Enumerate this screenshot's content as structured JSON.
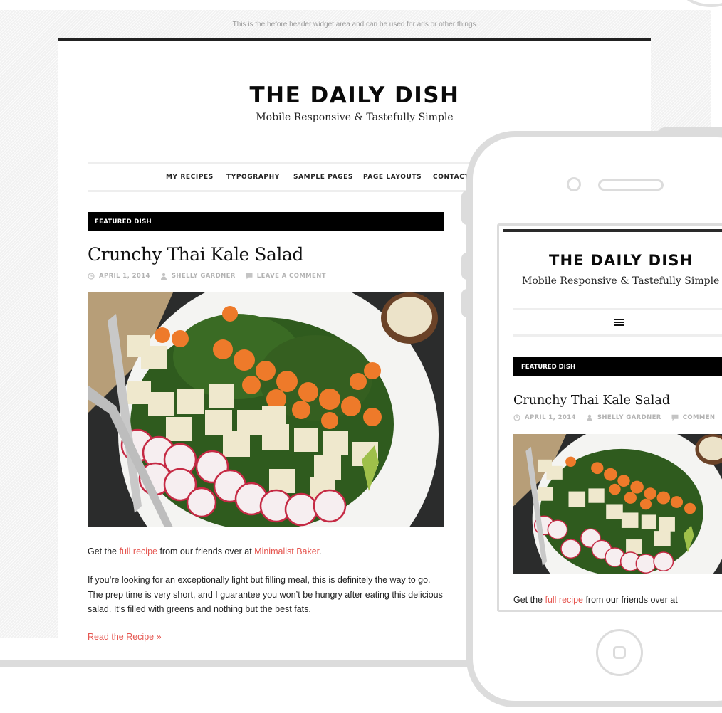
{
  "widget_area_text": "This is the before header widget area and can be used for ads or other things.",
  "site": {
    "title": "THE DAILY DISH",
    "tagline": "Mobile Responsive & Tastefully Simple"
  },
  "nav": {
    "items": [
      {
        "label": "MY RECIPES"
      },
      {
        "label": "TYPOGRAPHY"
      },
      {
        "label": "SAMPLE PAGES"
      },
      {
        "label": "PAGE LAYOUTS"
      },
      {
        "label": "CONTACT"
      }
    ],
    "mobile_menu_icon": "hamburger-menu-icon"
  },
  "section_label": "FEATURED DISH",
  "post": {
    "title": "Crunchy Thai Kale Salad",
    "date": "APRIL 1, 2014",
    "author": "SHELLY GARDNER",
    "comment_link": "LEAVE A COMMENT",
    "comment_link_mobile_truncated": "COMMEN",
    "image_alt": "Kale salad with carrots, tofu, radishes and lime on a white plate",
    "intro": {
      "prefix": "Get the ",
      "link1": "full recipe",
      "middle": " from our friends over at ",
      "link2": "Minimalist Baker",
      "suffix": "."
    },
    "paragraph": "If you’re looking for an exceptionally light but filling meal, this is definitely the way to go. The prep time is very short, and I guarantee you won’t be hungry after eating this delicious salad. It’s filled with greens and nothing but the best fats.",
    "read_more": "Read the Recipe »",
    "icons": {
      "date": "clock-icon",
      "author": "user-icon",
      "comments": "comment-icon"
    }
  },
  "mobile": {
    "tagline_truncated": "Mobile Responsive & Tastefully Simple",
    "intro_truncated": {
      "prefix": "Get the ",
      "link1": "full recipe",
      "middle": " from our friends over at"
    }
  },
  "colors": {
    "accent": "#e5554f",
    "bar": "#000000",
    "frame": "#dcdcdc",
    "meta": "#b3b3b3"
  }
}
